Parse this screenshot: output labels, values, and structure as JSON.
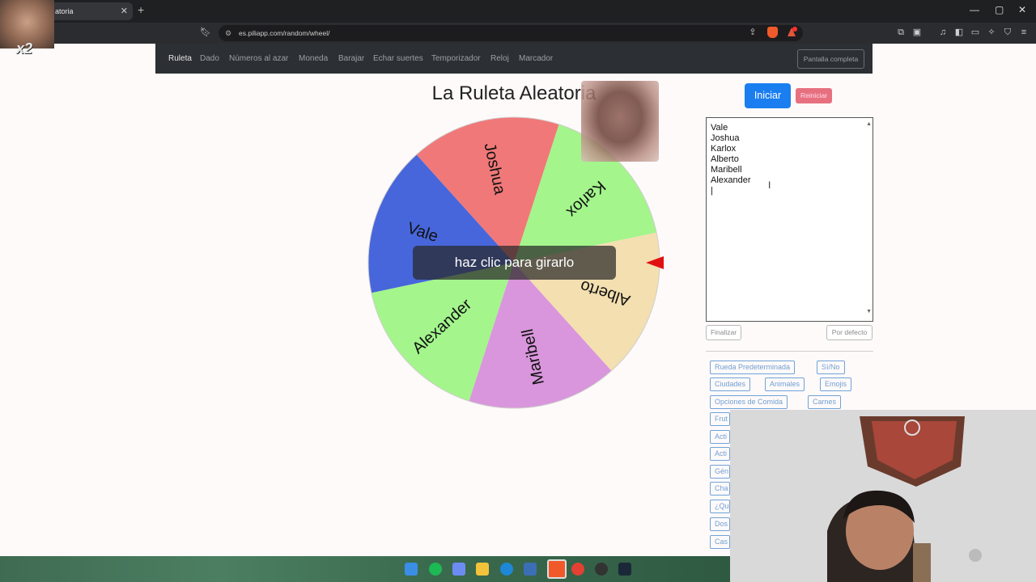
{
  "browser": {
    "tab_title": "atoria",
    "url": "es.piliapp.com/random/wheel/",
    "window_controls": {
      "minimize": "—",
      "maximize": "▢",
      "close": "✕"
    }
  },
  "site_nav": {
    "links": [
      "Ruleta",
      "Dado",
      "Números al azar",
      "Moneda",
      "Barajar",
      "Echar suertes",
      "Temporizador",
      "Reloj",
      "Marcador"
    ],
    "fullscreen_label": "Pantalla completa"
  },
  "page": {
    "title": "La Ruleta Aleatoria",
    "start_label": "Iniciar",
    "reset_label": "Reiniciar",
    "spin_hint": "haz clic para girarlo"
  },
  "wheel": {
    "segments": [
      {
        "label": "Vale",
        "color": "#4766db"
      },
      {
        "label": "Joshua",
        "color": "#f07878"
      },
      {
        "label": "Karlox",
        "color": "#a3f58c"
      },
      {
        "label": "Alberto",
        "color": "#f3dfb0"
      },
      {
        "label": "Maribell",
        "color": "#d996dc"
      },
      {
        "label": "Alexander",
        "color": "#a3f58c"
      }
    ],
    "pointer_color": "#e01010"
  },
  "names_list": [
    "Vale",
    "Joshua",
    "Karlox",
    "Alberto",
    "Maribell",
    "Alexander"
  ],
  "list_controls": {
    "finish_label": "Finalizar",
    "default_label": "Por defecto"
  },
  "presets": [
    "Rueda Predeterminada",
    "Sí/No",
    "Ciudades",
    "Animales",
    "Emojis",
    "Opciones de Comida",
    "Carnes",
    "Frut",
    "Acti",
    "Acti",
    "Gén",
    "Cha",
    "¿Qu",
    "Dos",
    "Cas"
  ],
  "overlay": {
    "multiplier": "x2"
  }
}
